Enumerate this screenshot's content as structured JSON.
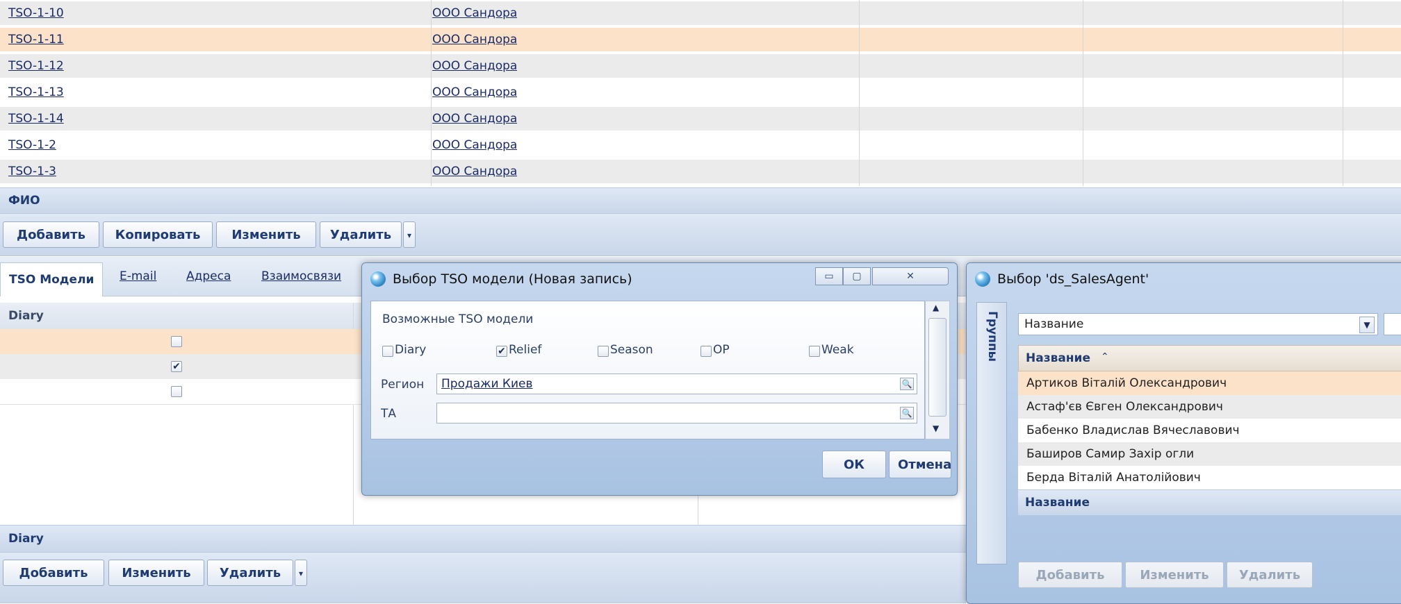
{
  "top_grid": {
    "rows": [
      {
        "code": "TSO-1-10",
        "company": "ООО Сандора"
      },
      {
        "code": "TSO-1-11",
        "company": "ООО Сандора"
      },
      {
        "code": "TSO-1-12",
        "company": "ООО Сандора"
      },
      {
        "code": "TSO-1-13",
        "company": "ООО Сандора"
      },
      {
        "code": "TSO-1-14",
        "company": "ООО Сандора"
      },
      {
        "code": "TSO-1-2",
        "company": "ООО Сандора"
      },
      {
        "code": "TSO-1-3",
        "company": "ООО Сандора"
      }
    ],
    "selected_row": 1,
    "footer_title": "ФИО"
  },
  "top_toolbar": {
    "add": "Добавить",
    "copy": "Копировать",
    "edit": "Изменить",
    "delete": "Удалить"
  },
  "lower_tabs": {
    "items": [
      "TSO Модели",
      "E-mail",
      "Адреса",
      "Взаимосвязи"
    ],
    "active": 0
  },
  "lower_grid": {
    "header": "Diary",
    "checks": [
      false,
      true,
      false
    ],
    "footer_title": "Diary"
  },
  "lower_toolbar": {
    "add": "Добавить",
    "edit": "Изменить",
    "delete": "Удалить"
  },
  "dialog_tso": {
    "title": "Выбор TSO модели (Новая запись)",
    "section_label": "Возможные TSO модели",
    "models": [
      {
        "label": "Diary",
        "checked": false
      },
      {
        "label": "Relief",
        "checked": true
      },
      {
        "label": "Season",
        "checked": false
      },
      {
        "label": "OP",
        "checked": false
      },
      {
        "label": "Weak",
        "checked": false
      }
    ],
    "region_label": "Регион",
    "region_value": "Продажи Киев",
    "ta_label": "ТА",
    "ta_value": "",
    "ok": "ОК",
    "cancel": "Отмена"
  },
  "dialog_agent": {
    "title": "Выбор 'ds_SalesAgent'",
    "groups_label": "Группы",
    "filter_field": "Название",
    "column_header": "Название",
    "items": [
      "Артиков Віталій Олександрович",
      "Астаф'єв Євген Олександрович",
      "Бабенко Владислав Вячеславович",
      "Баширов Самир Захір огли",
      "Берда Віталій Анатолійович"
    ],
    "selected_item": 0,
    "footer_title": "Название",
    "add": "Добавить",
    "edit": "Изменить",
    "delete": "Удалить"
  }
}
